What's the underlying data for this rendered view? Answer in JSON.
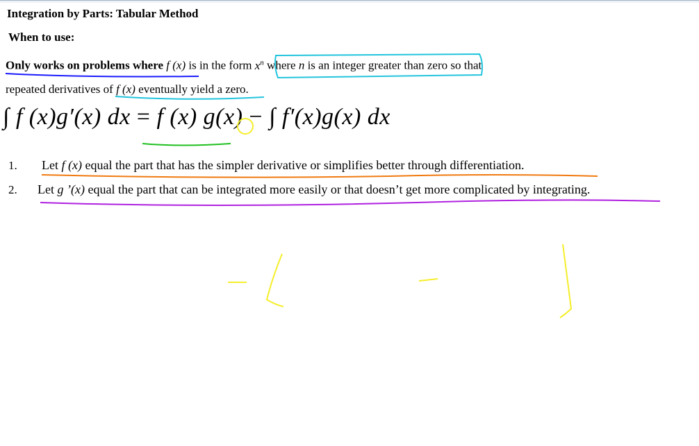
{
  "title": "Integration by Parts: Tabular Method",
  "when_heading": "When to use:",
  "line1": {
    "lead_bold": "Only works on problems where",
    "f_of_x": "f (x)",
    "in_the_form": "is in the form",
    "x": "x",
    "n_sup": "n",
    "where": "where",
    "n": "n",
    "condition": "is an integer greater than zero",
    "tail": "so that"
  },
  "line2": {
    "lead": "repeated derivatives of",
    "f_of_x": "f (x)",
    "tail": "eventually yield a zero."
  },
  "formula": {
    "integral": "∫",
    "lhs": "f (x)g′(x) dx",
    "equals": "=",
    "rhs_term": "f (x) g(x)",
    "minus": "−",
    "rhs_integral": "∫",
    "rhs_integrand": "f′(x)g(x) dx"
  },
  "steps": [
    {
      "number": "1.",
      "let": "Let",
      "var": "f (x)",
      "text": "equal the part that has the simpler derivative or simplifies better through differentiation."
    },
    {
      "number": "2.",
      "let": "Let",
      "var": "g ’(x)",
      "text": "equal the part that can be integrated more easily or that doesn’t get more complicated by integrating."
    }
  ],
  "annotation_colors": {
    "blue": "#1a1aff",
    "cyan": "#22c4dd",
    "green": "#1fbf1f",
    "orange": "#f07a10",
    "purple": "#b020e0",
    "yellow": "#f5ee2a"
  }
}
